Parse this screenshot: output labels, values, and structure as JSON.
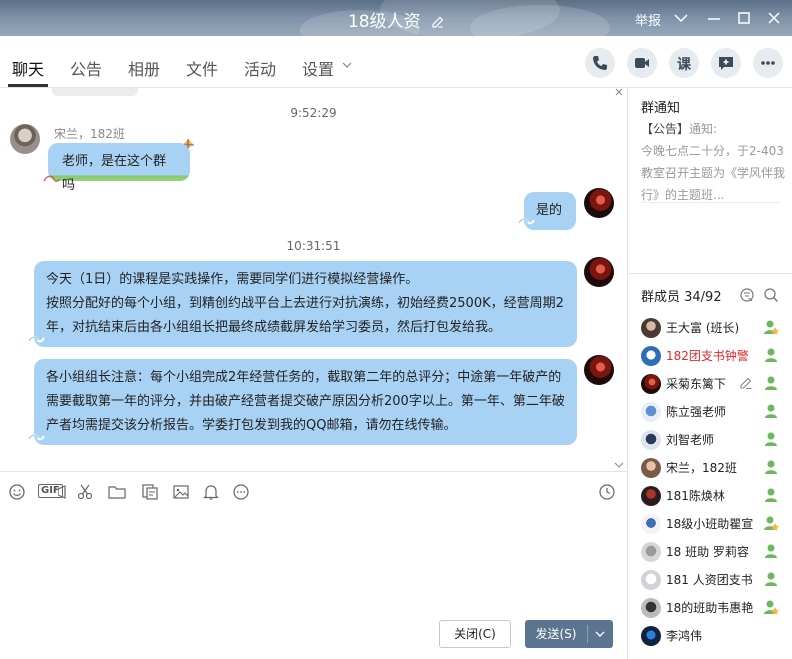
{
  "window": {
    "title": "18级人资",
    "report_label": "举报"
  },
  "tabs": [
    {
      "label": "聊天"
    },
    {
      "label": "公告"
    },
    {
      "label": "相册"
    },
    {
      "label": "文件"
    },
    {
      "label": "活动"
    },
    {
      "label": "设置"
    }
  ],
  "toolbar": {
    "course_label": "课"
  },
  "messages": {
    "time1": "9:52:29",
    "sender1": "宋兰，182班",
    "text1": "老师，是在这个群吗",
    "text2": "是的",
    "time2": "10:31:51",
    "text3": "今天（1日）的课程是实践操作，需要同学们进行模拟经营操作。\n按照分配好的每个小组，到精创约战平台上去进行对抗演练，初始经费2500K，经营周期2年，对抗结束后由各小组组长把最终成绩截屏发给学习委员，然后打包发给我。",
    "text4": "各小组组长注意：每个小组完成2年经营任务的，截取第二年的总评分；中途第一年破产的需要截取第一年的评分，并由破产经营者提交破产原因分析200字以上。第一年、第二年破产者均需提交该分析报告。学委打包发到我的QQ邮箱，请勿在线传输。"
  },
  "input": {
    "gif_label": "GIF",
    "close_label": "关闭(C)",
    "send_label": "发送(S)"
  },
  "notice": {
    "title": "群通知",
    "tag": "【公告】",
    "body_prefix": "通知:",
    "body": "今晚七点二十分，于2-403教室召开主题为《学风伴我行》的主题班..."
  },
  "members": {
    "title": "群成员 34/92",
    "items": [
      {
        "name": "王大富 (班长)",
        "role": "owner",
        "highlight": false
      },
      {
        "name": "182团支书钟警",
        "role": "member",
        "highlight": true
      },
      {
        "name": "采菊东篱下",
        "role": "member",
        "highlight": false,
        "editing": true
      },
      {
        "name": "陈立强老师",
        "role": "member",
        "highlight": false
      },
      {
        "name": "刘智老师",
        "role": "member",
        "highlight": false
      },
      {
        "name": "宋兰，182班",
        "role": "member",
        "highlight": false
      },
      {
        "name": "181陈焕林",
        "role": "member",
        "highlight": false
      },
      {
        "name": "18级小班助瞿宣",
        "role": "admin",
        "highlight": false
      },
      {
        "name": "18 班助 罗莉容",
        "role": "member",
        "highlight": false
      },
      {
        "name": "181 人资团支书",
        "role": "member",
        "highlight": false
      },
      {
        "name": "18的班助韦惠艳",
        "role": "admin",
        "highlight": false
      },
      {
        "name": "李鸿伟",
        "role": "none",
        "highlight": false
      }
    ]
  },
  "colors": {
    "bubble": "#a8d2f4",
    "send_button": "#5b7590",
    "highlight_name": "#e0282c"
  }
}
